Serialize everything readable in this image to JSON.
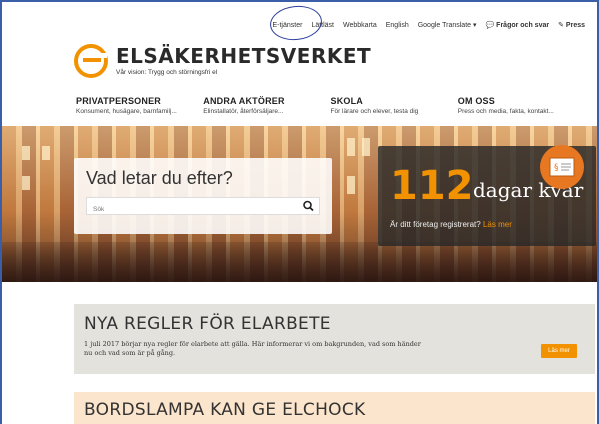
{
  "topbar": {
    "eservices": "E-tjänster",
    "easyread": "Lättläst",
    "sitemap": "Webbkarta",
    "english": "English",
    "translate": "Google Translate ▾",
    "faq": "Frågor och svar",
    "press": "Press"
  },
  "logo": {
    "name": "ELSÄKERHETSVERKET",
    "vision": "Vår vision: Trygg och störningsfri el"
  },
  "nav": [
    {
      "title": "PRIVATPERSONER",
      "sub": "Konsument, husägare, barnfamilj..."
    },
    {
      "title": "ANDRA AKTÖRER",
      "sub": "Elinstallatör, återförsäljare..."
    },
    {
      "title": "SKOLA",
      "sub": "För lärare och elever, testa dig"
    },
    {
      "title": "OM OSS",
      "sub": "Press och media, fakta, kontakt..."
    }
  ],
  "hero": {
    "search_title": "Vad letar du efter?",
    "search_placeholder": "Sök",
    "counter_number": "112",
    "counter_label": "dagar kvar",
    "counter_question": "Är ditt företag registrerat?",
    "counter_link": "Läs mer"
  },
  "news": [
    {
      "title": "NYA REGLER FÖR ELARBETE",
      "text": "1 juli 2017 börjar nya regler för elarbete att gälla. Här informerar vi om bakgrunden, vad som händer nu och vad som är på gång.",
      "button": "Läs mer"
    },
    {
      "title": "BORDSLAMPA KAN GE ELCHOCK"
    }
  ],
  "colors": {
    "accent": "#f39200",
    "annotation": "#2d3f9e"
  }
}
